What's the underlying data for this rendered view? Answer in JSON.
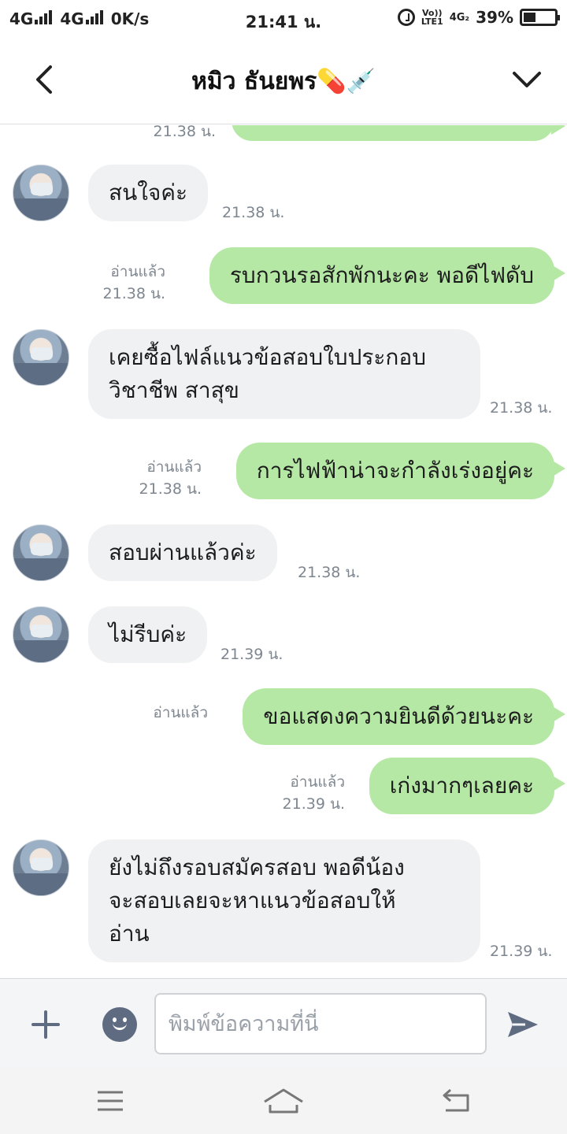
{
  "status_bar": {
    "network1": "4G",
    "network2": "4G",
    "speed": "0K/s",
    "time": "21:41 น.",
    "volte": "Vo))",
    "lte": "LTE1",
    "net4g": "4G₂",
    "battery": "39%",
    "battery_level": 0.39
  },
  "header": {
    "title": "หมิว ธันยพร💊💉"
  },
  "messages": [
    {
      "dir": "in",
      "text": "สนใจค่ะ",
      "time": "21.38 น."
    },
    {
      "dir": "out",
      "text": "รบกวนรอสักพักนะคะ พอดีไฟดับ",
      "read": "อ่านแล้ว",
      "time": "21.38 น."
    },
    {
      "dir": "in",
      "text1": "เคยซื้อไฟล์แนวข้อสอบใบประกอบ",
      "text2": "วิชาชีพ  สาสุข",
      "time": "21.38 น."
    },
    {
      "dir": "out",
      "text": "การไฟฟ้าน่าจะกำลังเร่งอยู่คะ",
      "read": "อ่านแล้ว",
      "time": "21.38 น."
    },
    {
      "dir": "in",
      "text": "สอบผ่านแล้วค่ะ",
      "time": "21.38 น."
    },
    {
      "dir": "in",
      "text": "ไม่รีบค่ะ",
      "time": "21.39 น."
    },
    {
      "dir": "out",
      "text": "ขอแสดงความยินดีด้วยนะคะ",
      "read": "อ่านแล้ว",
      "time": ""
    },
    {
      "dir": "out",
      "text": "เก่งมากๆเลยคะ",
      "read": "อ่านแล้ว",
      "time": "21.39 น."
    },
    {
      "dir": "in",
      "text1": "ยังไม่ถึงรอบสมัครสอบ  พอดีน้อง",
      "text2": "จะสอบเลยจะหาแนวข้อสอบให้",
      "text3": "อ่าน",
      "time": "21.39 น."
    }
  ],
  "partial_top_time": "21.38 น.",
  "input": {
    "placeholder": "พิมพ์ข้อความที่นี่"
  },
  "colors": {
    "outgoing_bubble": "#b5e8a5",
    "incoming_bubble": "#f0f1f3",
    "icon": "#5f6b80"
  }
}
